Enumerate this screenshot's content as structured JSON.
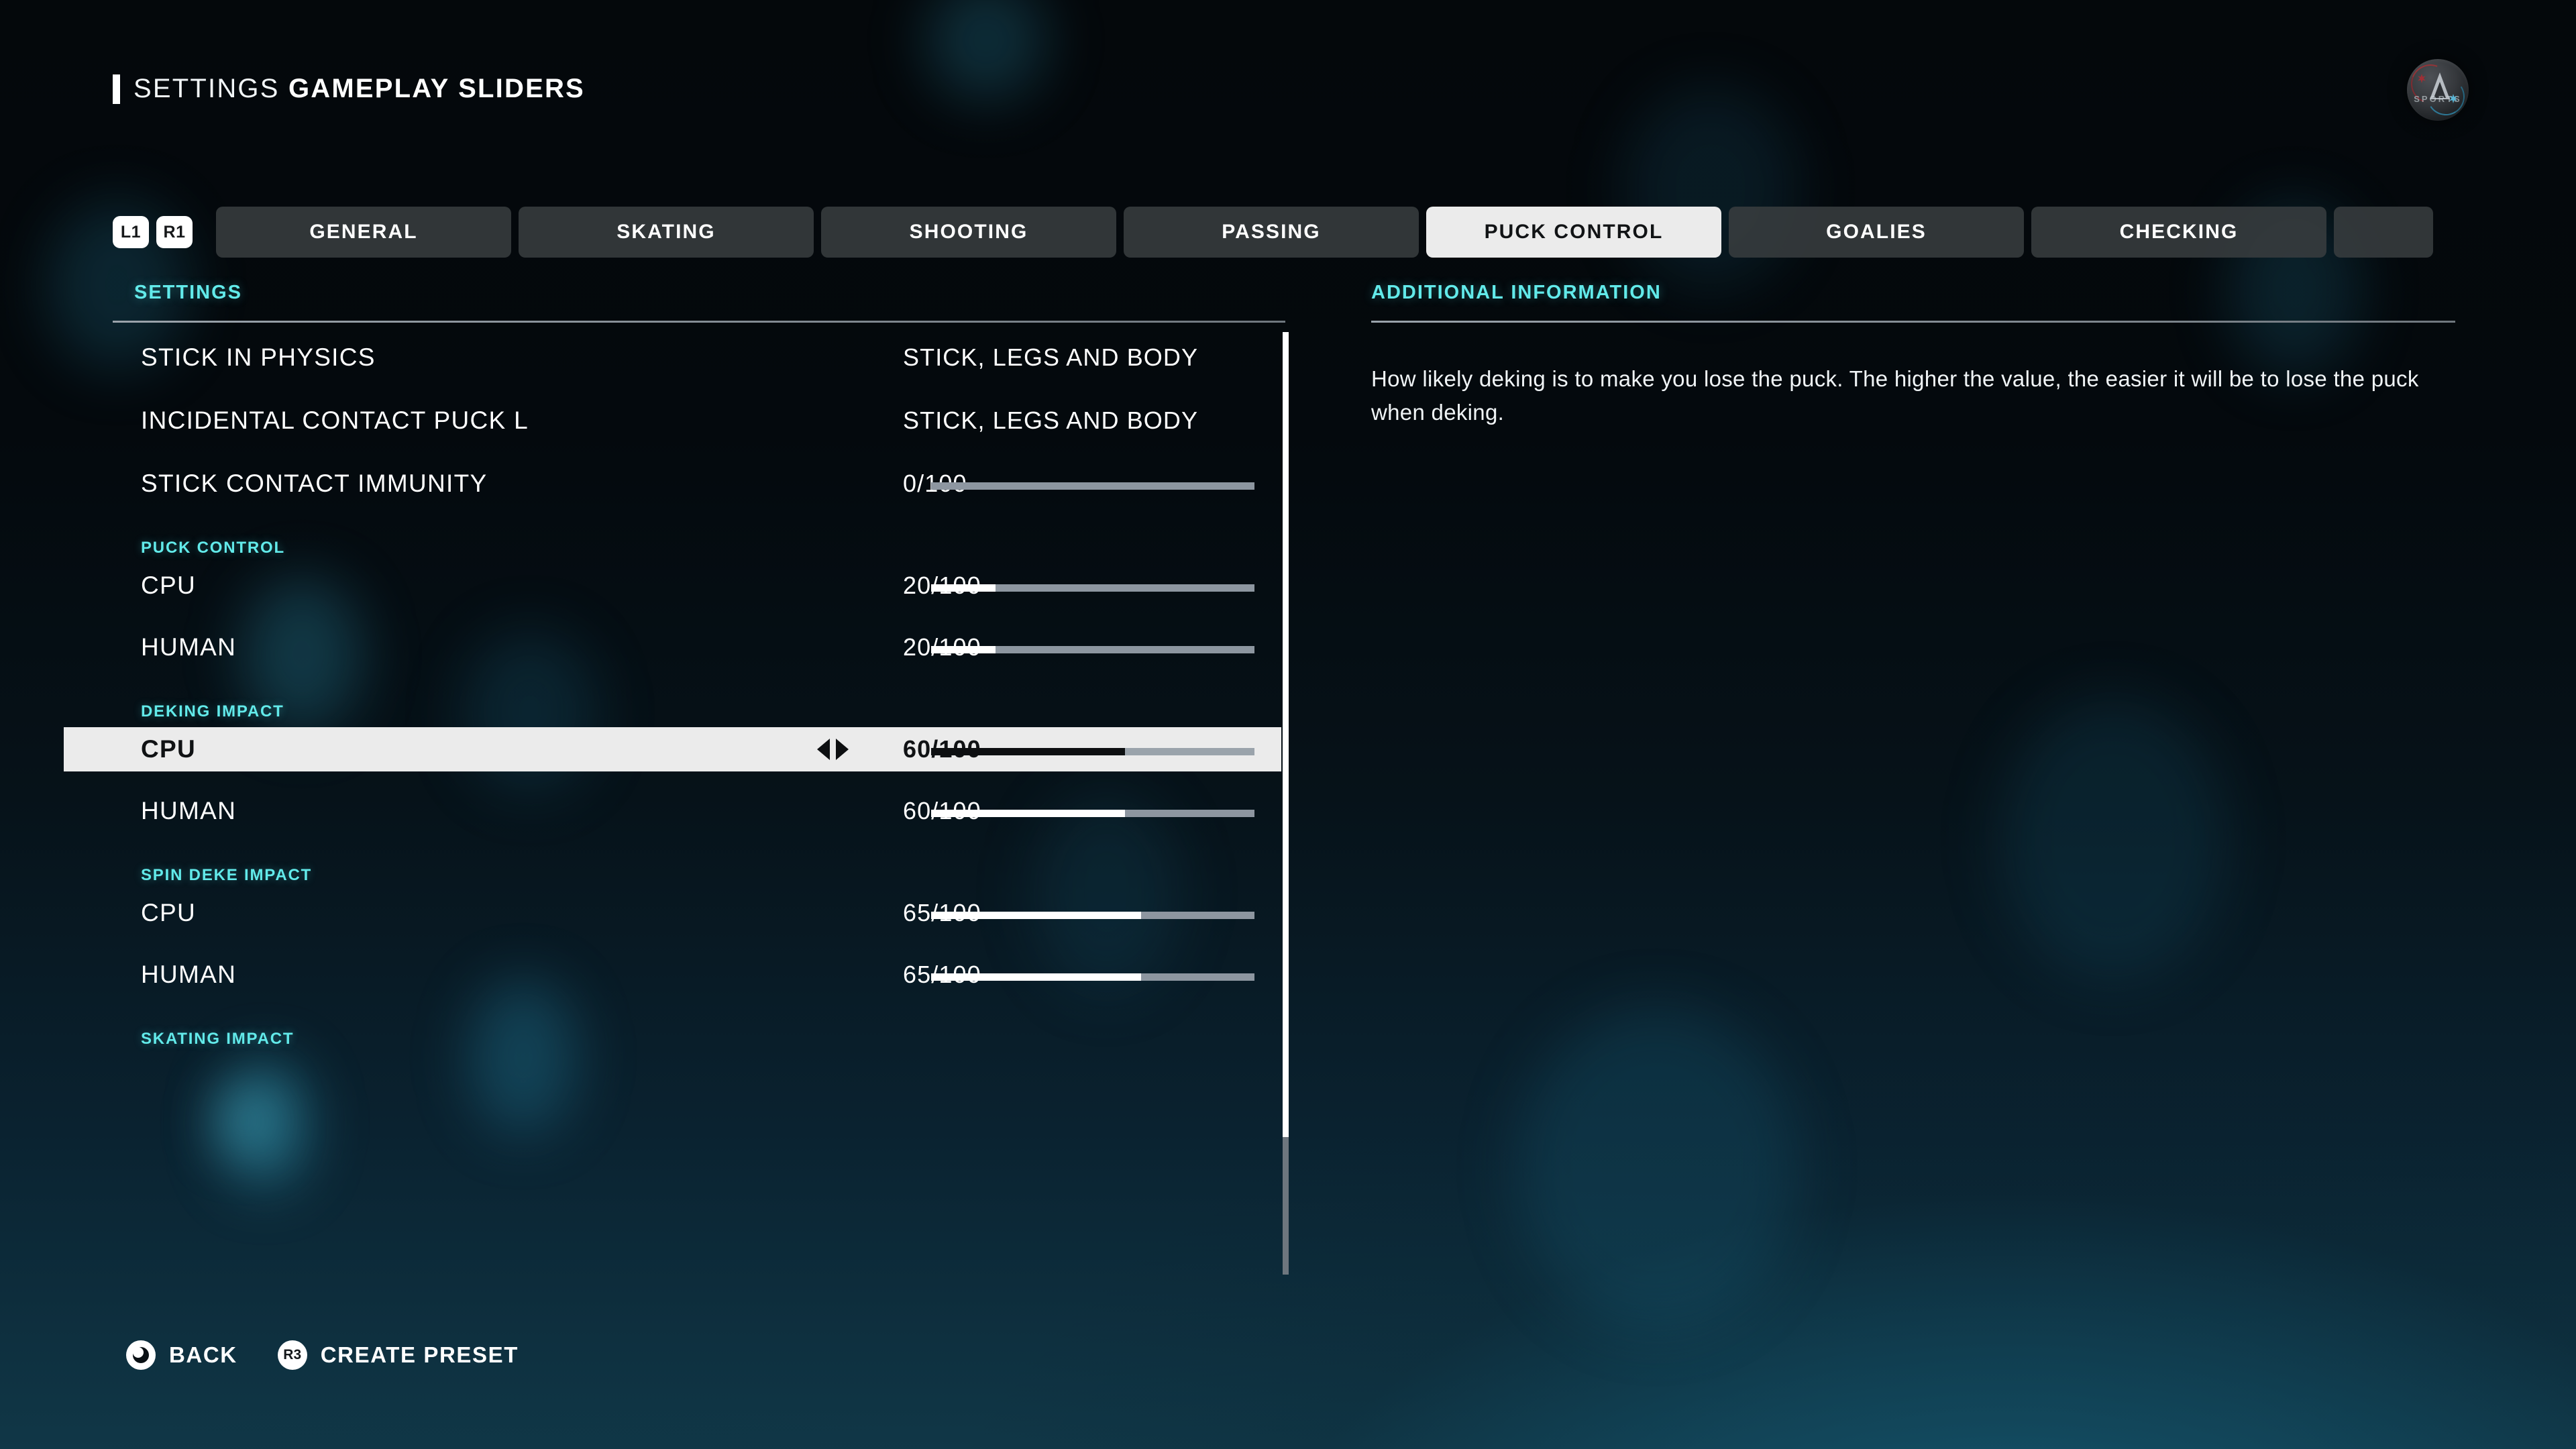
{
  "header": {
    "title_thin": "SETTINGS",
    "title_bold": "GAMEPLAY SLIDERS",
    "logo_name": "ea-sports-logo",
    "logo_wordmark": "SPORTS"
  },
  "tabbar": {
    "prev_key": "L1",
    "next_key": "R1",
    "tabs": [
      {
        "label": "GENERAL",
        "active": false
      },
      {
        "label": "SKATING",
        "active": false
      },
      {
        "label": "SHOOTING",
        "active": false
      },
      {
        "label": "PASSING",
        "active": false
      },
      {
        "label": "PUCK CONTROL",
        "active": true
      },
      {
        "label": "GOALIES",
        "active": false
      },
      {
        "label": "CHECKING",
        "active": false
      }
    ],
    "partial_tab_label": ""
  },
  "columns": {
    "settings_header": "SETTINGS",
    "info_header": "ADDITIONAL INFORMATION"
  },
  "settings": {
    "rows": [
      {
        "kind": "option",
        "label": "STICK IN PHYSICS",
        "value": "STICK, LEGS AND BODY",
        "selected": false
      },
      {
        "kind": "option",
        "label": "INCIDENTAL CONTACT PUCK L",
        "value": "STICK, LEGS AND BODY",
        "selected": false
      },
      {
        "kind": "slider",
        "label": "STICK CONTACT IMMUNITY",
        "value": "0/100",
        "percent": 0,
        "selected": false
      },
      {
        "kind": "group",
        "label": "PUCK CONTROL"
      },
      {
        "kind": "slider",
        "label": "CPU",
        "value": "20/100",
        "percent": 20,
        "selected": false
      },
      {
        "kind": "slider",
        "label": "HUMAN",
        "value": "20/100",
        "percent": 20,
        "selected": false
      },
      {
        "kind": "group",
        "label": "DEKING IMPACT"
      },
      {
        "kind": "slider",
        "label": "CPU",
        "value": "60/100",
        "percent": 60,
        "selected": true
      },
      {
        "kind": "slider",
        "label": "HUMAN",
        "value": "60/100",
        "percent": 60,
        "selected": false
      },
      {
        "kind": "group",
        "label": "SPIN DEKE IMPACT"
      },
      {
        "kind": "slider",
        "label": "CPU",
        "value": "65/100",
        "percent": 65,
        "selected": false
      },
      {
        "kind": "slider",
        "label": "HUMAN",
        "value": "65/100",
        "percent": 65,
        "selected": false
      },
      {
        "kind": "group",
        "label": "SKATING IMPACT"
      }
    ]
  },
  "info": {
    "text": "How likely deking is to make you lose the puck. The higher the value, the easier it will be to lose the puck when deking."
  },
  "footer": {
    "buttons": [
      {
        "glyph": "circle-button-icon",
        "glyph_text": "",
        "label": "BACK"
      },
      {
        "glyph": "r3-stick-button-icon",
        "glyph_text": "R3",
        "label": "CREATE PRESET"
      }
    ]
  },
  "colors": {
    "accent_cyan": "#62eaea",
    "selected_row_bg": "#ebebeb",
    "slider_track": "#8d96a0",
    "slider_fill": "#ffffff",
    "tab_bg": "#383c3f",
    "tab_active_bg": "#ebebeb"
  }
}
